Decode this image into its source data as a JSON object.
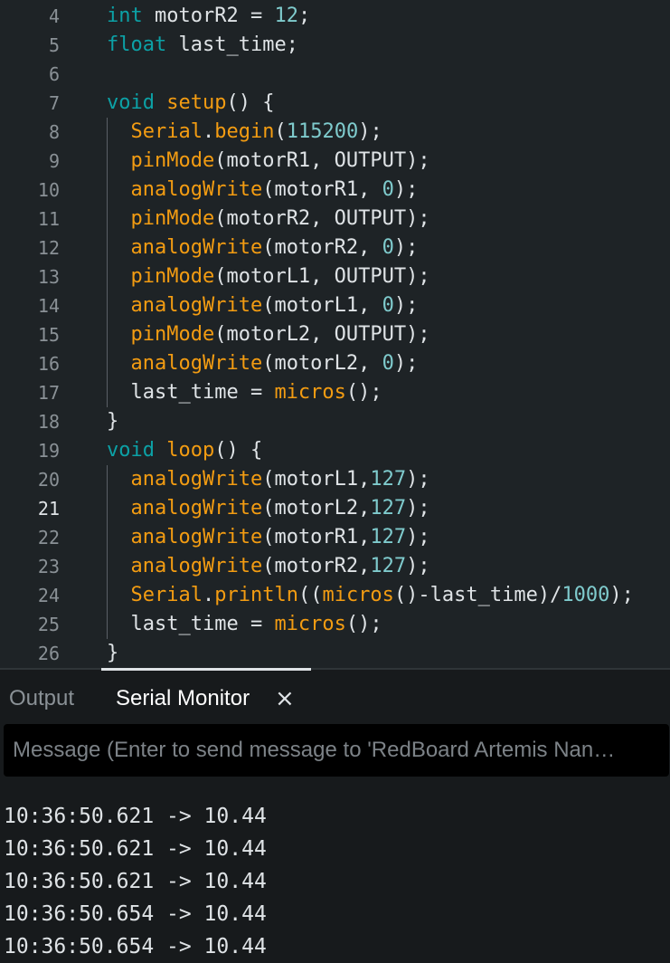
{
  "editor": {
    "active_line": "21",
    "lines": [
      {
        "num": "4",
        "tokens": [
          [
            "int",
            "kw"
          ],
          [
            " motorR2 = ",
            ""
          ],
          [
            "12",
            "num"
          ],
          [
            ";",
            ""
          ]
        ]
      },
      {
        "num": "5",
        "tokens": [
          [
            "float",
            "kw"
          ],
          [
            " last_time;",
            ""
          ]
        ]
      },
      {
        "num": "6",
        "tokens": []
      },
      {
        "num": "7",
        "tokens": [
          [
            "void",
            "kw"
          ],
          [
            " ",
            ""
          ],
          [
            "setup",
            "fn"
          ],
          [
            "() {",
            ""
          ]
        ]
      },
      {
        "num": "8",
        "tokens": [
          [
            "  ",
            ""
          ],
          [
            "Serial",
            "fn"
          ],
          [
            ".",
            ""
          ],
          [
            "begin",
            "fn"
          ],
          [
            "(",
            ""
          ],
          [
            "115200",
            "num"
          ],
          [
            ");",
            ""
          ]
        ]
      },
      {
        "num": "9",
        "tokens": [
          [
            "  ",
            ""
          ],
          [
            "pinMode",
            "fn"
          ],
          [
            "(motorR1, OUTPUT);",
            ""
          ]
        ]
      },
      {
        "num": "10",
        "tokens": [
          [
            "  ",
            ""
          ],
          [
            "analogWrite",
            "fn"
          ],
          [
            "(motorR1, ",
            ""
          ],
          [
            "0",
            "num"
          ],
          [
            ");",
            ""
          ]
        ]
      },
      {
        "num": "11",
        "tokens": [
          [
            "  ",
            ""
          ],
          [
            "pinMode",
            "fn"
          ],
          [
            "(motorR2, OUTPUT);",
            ""
          ]
        ]
      },
      {
        "num": "12",
        "tokens": [
          [
            "  ",
            ""
          ],
          [
            "analogWrite",
            "fn"
          ],
          [
            "(motorR2, ",
            ""
          ],
          [
            "0",
            "num"
          ],
          [
            ");",
            ""
          ]
        ]
      },
      {
        "num": "13",
        "tokens": [
          [
            "  ",
            ""
          ],
          [
            "pinMode",
            "fn"
          ],
          [
            "(motorL1, OUTPUT);",
            ""
          ]
        ]
      },
      {
        "num": "14",
        "tokens": [
          [
            "  ",
            ""
          ],
          [
            "analogWrite",
            "fn"
          ],
          [
            "(motorL1, ",
            ""
          ],
          [
            "0",
            "num"
          ],
          [
            ");",
            ""
          ]
        ]
      },
      {
        "num": "15",
        "tokens": [
          [
            "  ",
            ""
          ],
          [
            "pinMode",
            "fn"
          ],
          [
            "(motorL2, OUTPUT);",
            ""
          ]
        ]
      },
      {
        "num": "16",
        "tokens": [
          [
            "  ",
            ""
          ],
          [
            "analogWrite",
            "fn"
          ],
          [
            "(motorL2, ",
            ""
          ],
          [
            "0",
            "num"
          ],
          [
            ");",
            ""
          ]
        ]
      },
      {
        "num": "17",
        "tokens": [
          [
            "  last_time = ",
            ""
          ],
          [
            "micros",
            "fn"
          ],
          [
            "();",
            ""
          ]
        ]
      },
      {
        "num": "18",
        "tokens": [
          [
            "}",
            ""
          ]
        ]
      },
      {
        "num": "19",
        "tokens": [
          [
            "void",
            "kw"
          ],
          [
            " ",
            ""
          ],
          [
            "loop",
            "fn"
          ],
          [
            "() {",
            ""
          ]
        ]
      },
      {
        "num": "20",
        "tokens": [
          [
            "  ",
            ""
          ],
          [
            "analogWrite",
            "fn"
          ],
          [
            "(motorL1,",
            ""
          ],
          [
            "127",
            "num"
          ],
          [
            ");",
            ""
          ]
        ]
      },
      {
        "num": "21",
        "tokens": [
          [
            "  ",
            ""
          ],
          [
            "analogWrite",
            "fn"
          ],
          [
            "(motorL2,",
            ""
          ],
          [
            "127",
            "num"
          ],
          [
            ");",
            ""
          ]
        ]
      },
      {
        "num": "22",
        "tokens": [
          [
            "  ",
            ""
          ],
          [
            "analogWrite",
            "fn"
          ],
          [
            "(motorR1,",
            ""
          ],
          [
            "127",
            "num"
          ],
          [
            ");",
            ""
          ]
        ]
      },
      {
        "num": "23",
        "tokens": [
          [
            "  ",
            ""
          ],
          [
            "analogWrite",
            "fn"
          ],
          [
            "(motorR2,",
            ""
          ],
          [
            "127",
            "num"
          ],
          [
            ");",
            ""
          ]
        ]
      },
      {
        "num": "24",
        "tokens": [
          [
            "  ",
            ""
          ],
          [
            "Serial",
            "fn"
          ],
          [
            ".",
            ""
          ],
          [
            "println",
            "fn"
          ],
          [
            "((",
            ""
          ],
          [
            "micros",
            "fn"
          ],
          [
            "()-last_time)/",
            ""
          ],
          [
            "1000",
            "num"
          ],
          [
            ");",
            ""
          ]
        ]
      },
      {
        "num": "25",
        "tokens": [
          [
            "  last_time = ",
            ""
          ],
          [
            "micros",
            "fn"
          ],
          [
            "();",
            ""
          ]
        ]
      },
      {
        "num": "26",
        "tokens": [
          [
            "}",
            ""
          ]
        ]
      }
    ]
  },
  "panel": {
    "tabs": [
      {
        "label": "Output",
        "active": false
      },
      {
        "label": "Serial Monitor",
        "active": true
      }
    ],
    "close_icon": "×",
    "message_placeholder": "Message (Enter to send message to 'RedBoard Artemis Nan…",
    "output_lines": [
      "10:36:50.621 -> 10.44",
      "10:36:50.621 -> 10.44",
      "10:36:50.621 -> 10.44",
      "10:36:50.654 -> 10.44",
      "10:36:50.654 -> 10.44"
    ]
  },
  "colors": {
    "keyword": "#0ca1a6",
    "function": "#f39c12",
    "number": "#7fcbcd",
    "text": "#dfe3e6",
    "editor_bg": "#1e2326",
    "panel_bg": "#171a1c"
  }
}
